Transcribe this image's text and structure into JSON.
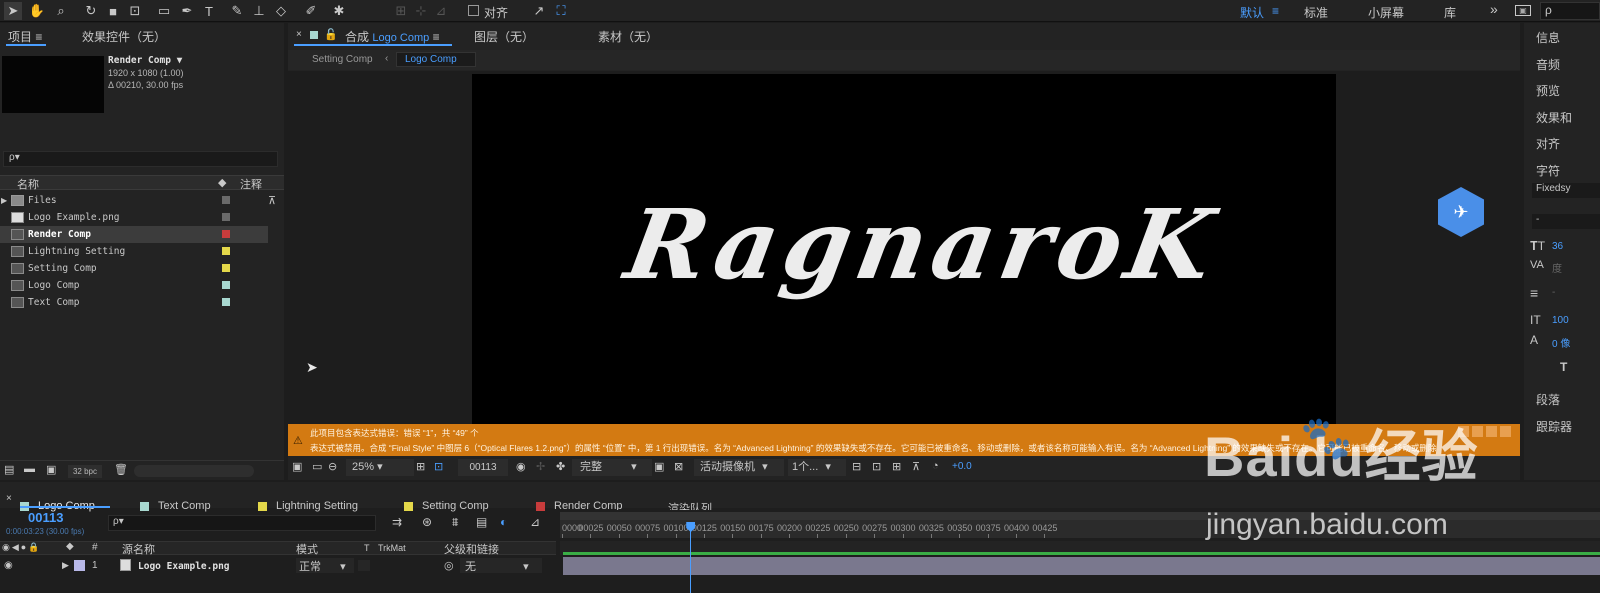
{
  "toolbar": {
    "snap_label": "对齐",
    "workspaces": {
      "default": "默认",
      "standard": "标准",
      "small_screen": "小屏幕",
      "library": "库"
    },
    "more": "»"
  },
  "project_panel": {
    "tab_project": "项目",
    "tab_effects": "效果控件（无）",
    "preview": {
      "name": "Render Comp ▼",
      "resolution": "1920 x 1080 (1.00)",
      "duration": "Δ 00210, 30.00 fps"
    },
    "search_icon": "ρ▾",
    "col_name": "名称",
    "col_comment": "注释",
    "items": [
      {
        "name": "Files",
        "type": "folder",
        "label_color": "#6a6a6a"
      },
      {
        "name": "Logo Example.png",
        "type": "image",
        "label_color": "#6a6a6a"
      },
      {
        "name": "Render Comp",
        "type": "comp",
        "label_color": "#c83c3c",
        "selected": true
      },
      {
        "name": "Lightning Setting",
        "type": "comp",
        "label_color": "#e4d84a"
      },
      {
        "name": "Setting Comp",
        "type": "comp",
        "label_color": "#e4d84a"
      },
      {
        "name": "Logo Comp",
        "type": "comp",
        "label_color": "#a8d8d0"
      },
      {
        "name": "Text Comp",
        "type": "comp",
        "label_color": "#a8d8d0"
      }
    ],
    "bpc": "32 bpc"
  },
  "comp_panel": {
    "close": "×",
    "tab_comp_prefix": "合成",
    "tab_comp_name": "Logo Comp",
    "tab_layer": "图层（无）",
    "tab_footage": "素材（无）",
    "breadcrumb": [
      "Setting Comp",
      "Logo Comp"
    ],
    "logo_text": "RagnaroK",
    "error_line1": "此项目包含表达式错误：错误 “1”，共 “49” 个",
    "error_line2": "表达式被禁用。合成 “Final Style” 中图层 6（“Optical Flares 1.2.png”）的属性 “位置” 中，第 1 行出现错误。名为 “Advanced Lightning” 的效果缺失或不存在。它可能已被重命名、移动或删除，或者该名称可能输入有误。名为 “Advanced Lightning” 的效果缺失或不存在。它可能已被重命名、移动或删除",
    "zoom": "25%",
    "frame": "00113",
    "quality": "完整",
    "camera": "活动摄像机",
    "views": "1个...",
    "exposure": "+0.0"
  },
  "right_panel": {
    "items": [
      "信息",
      "音频",
      "预览",
      "效果和",
      "对齐",
      "字符"
    ],
    "font": "Fixedsy",
    "font_style": "-",
    "size": "36",
    "tracking_label": "度",
    "v_scale": "100",
    "baseline": "0 像",
    "paragraph": "段落",
    "tracker": "跟踪器"
  },
  "timeline": {
    "tabs": [
      {
        "name": "Logo Comp",
        "color": "#a8d8d0",
        "active": true
      },
      {
        "name": "Text Comp",
        "color": "#a8d8d0"
      },
      {
        "name": "Lightning Setting",
        "color": "#e4d84a"
      },
      {
        "name": "Setting Comp",
        "color": "#e4d84a"
      },
      {
        "name": "Render Comp",
        "color": "#c83c3c"
      }
    ],
    "render_queue": "渲染队列",
    "current_frame": "00113",
    "timecode": "0:00:03:23 (30.00 fps)",
    "ruler": [
      "0000",
      "00025",
      "00050",
      "00075",
      "00100",
      "00125",
      "00150",
      "00175",
      "00200",
      "00225",
      "00250",
      "00275",
      "00300",
      "00325",
      "00350",
      "00375",
      "00400",
      "00425"
    ],
    "playhead_frame": 113,
    "total_frames": 440,
    "col_num": "#",
    "col_source": "源名称",
    "col_mode": "模式",
    "col_t": "T",
    "col_trkmat": "TrkMat",
    "col_parent": "父级和链接",
    "layer": {
      "index": "1",
      "name": "Logo Example.png",
      "mode": "正常",
      "parent": "无",
      "color": "#b8b8e8"
    }
  },
  "watermark": {
    "brand": "Baidu经验",
    "url": "jingyan.baidu.com"
  }
}
